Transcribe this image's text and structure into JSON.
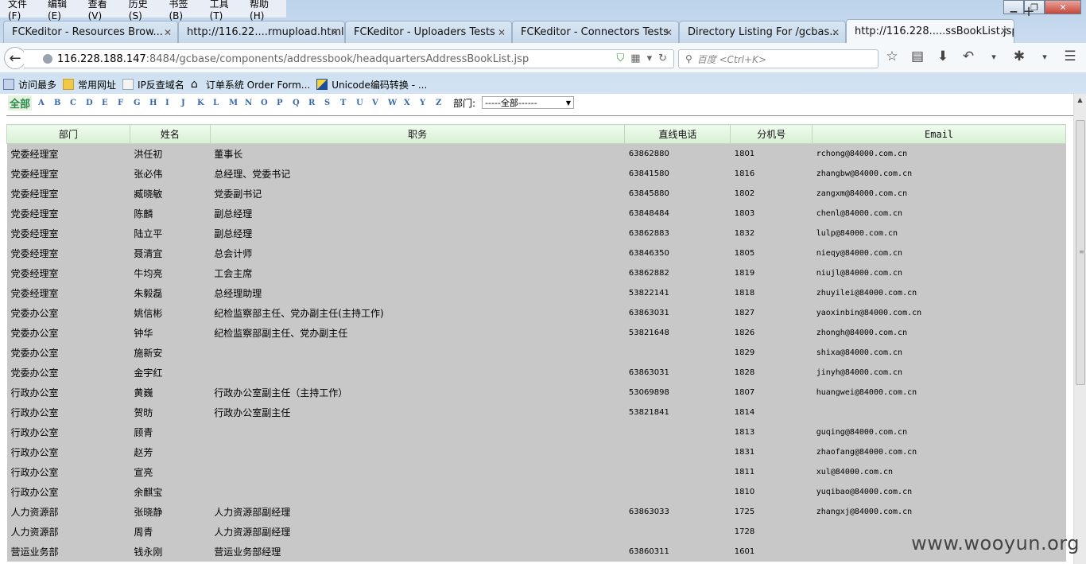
{
  "menu": [
    "文件(F)",
    "编辑(E)",
    "查看(V)",
    "历史(S)",
    "书签(B)",
    "工具(T)",
    "帮助(H)"
  ],
  "tabs": [
    {
      "label": "FCKeditor - Resources Brow..."
    },
    {
      "label": "http://116.22....rmupload.html"
    },
    {
      "label": "FCKeditor - Uploaders Tests"
    },
    {
      "label": "FCKeditor - Connectors Tests"
    },
    {
      "label": "Directory Listing For /gcbas..."
    },
    {
      "label": "http://116.228.....ssBookList.jsp"
    }
  ],
  "url": {
    "host": "116.228.188.147",
    "path": ":8484/gcbase/components/addressbook/headquartersAddressBookList.jsp"
  },
  "search": {
    "placeholder": "百度 <Ctrl+K>"
  },
  "bookmarks": [
    "访问最多",
    "常用网址",
    "IP反查域名",
    "订单系统 Order Form...",
    "Unicode编码转换 - ..."
  ],
  "filter": {
    "all_label": "全部",
    "letters": [
      "A",
      "B",
      "C",
      "D",
      "E",
      "F",
      "G",
      "H",
      "I",
      "J",
      "K",
      "L",
      "M",
      "N",
      "O",
      "P",
      "Q",
      "R",
      "S",
      "T",
      "U",
      "V",
      "W",
      "X",
      "Y",
      "Z"
    ],
    "dept_label": "部门:",
    "dept_value": "-----全部------"
  },
  "table": {
    "headers": [
      "部门",
      "姓名",
      "职务",
      "直线电话",
      "分机号",
      "Email"
    ],
    "rows": [
      [
        "党委经理室",
        "洪任初",
        "董事长",
        "63862880",
        "1801",
        "rchong@84000.com.cn"
      ],
      [
        "党委经理室",
        "张必伟",
        "总经理、党委书记",
        "63841580",
        "1816",
        "zhangbw@84000.com.cn"
      ],
      [
        "党委经理室",
        "臧晓敏",
        "党委副书记",
        "63845880",
        "1802",
        "zangxm@84000.com.cn"
      ],
      [
        "党委经理室",
        "陈麟",
        "副总经理",
        "63848484",
        "1803",
        "chenl@84000.com.cn"
      ],
      [
        "党委经理室",
        "陆立平",
        "副总经理",
        "63862883",
        "1832",
        "lulp@84000.com.cn"
      ],
      [
        "党委经理室",
        "聂清宜",
        "总会计师",
        "63846350",
        "1805",
        "nieqy@84000.com.cn"
      ],
      [
        "党委经理室",
        "牛均亮",
        "工会主席",
        "63862882",
        "1819",
        "niujl@84000.com.cn"
      ],
      [
        "党委经理室",
        "朱毅磊",
        "总经理助理",
        "53822141",
        "1818",
        "zhuyilei@84000.com.cn"
      ],
      [
        "党委办公室",
        "姚信彬",
        "纪检监察部主任、党办副主任(主持工作)",
        "63863031",
        "1827",
        "yaoxinbin@84000.com.cn"
      ],
      [
        "党委办公室",
        "钟华",
        "纪检监察部副主任、党办副主任",
        "53821648",
        "1826",
        "zhongh@84000.com.cn"
      ],
      [
        "党委办公室",
        "施新安",
        "",
        "",
        "1829",
        "shixa@84000.com.cn"
      ],
      [
        "党委办公室",
        "金宇红",
        "",
        "63863031",
        "1828",
        "jinyh@84000.com.cn"
      ],
      [
        "行政办公室",
        "黄巍",
        "行政办公室副主任（主持工作）",
        "53069898",
        "1807",
        "huangwei@84000.com.cn"
      ],
      [
        "行政办公室",
        "贺昉",
        "行政办公室副主任",
        "53821841",
        "1814",
        ""
      ],
      [
        "行政办公室",
        "顾青",
        "",
        "",
        "1813",
        "guqing@84000.com.cn"
      ],
      [
        "行政办公室",
        "赵芳",
        "",
        "",
        "1831",
        "zhaofang@84000.com.cn"
      ],
      [
        "行政办公室",
        "宣亮",
        "",
        "",
        "1811",
        "xul@84000.com.cn"
      ],
      [
        "行政办公室",
        "余麒宝",
        "",
        "",
        "1810",
        "yuqibao@84000.com.cn"
      ],
      [
        "人力资源部",
        "张晓静",
        "人力资源部副经理",
        "63863033",
        "1725",
        "zhangxj@84000.com.cn"
      ],
      [
        "人力资源部",
        "周青",
        "人力资源部副经理",
        "",
        "1728",
        ""
      ],
      [
        "营运业务部",
        "钱永刚",
        "营运业务部经理",
        "63860311",
        "1601",
        ""
      ]
    ]
  },
  "watermark": "www.wooyun.org"
}
